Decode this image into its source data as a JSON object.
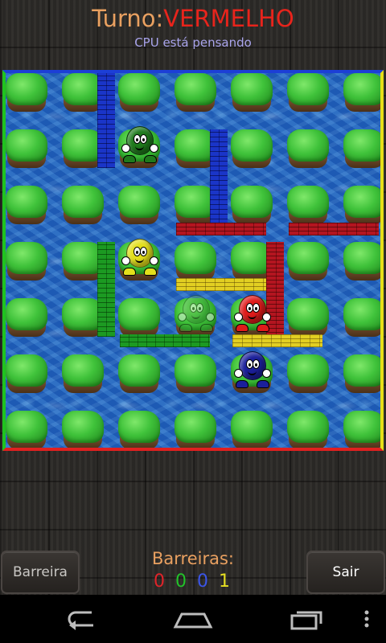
{
  "header": {
    "turn_label": "Turno:",
    "turn_player": "VERMELHO",
    "status": "CPU está pensando"
  },
  "board": {
    "rows": 7,
    "cols": 7,
    "border_colors": {
      "top": "#1c3fd6",
      "bottom": "#e02020",
      "left": "#1fc31f",
      "right": "#e6df18"
    },
    "pawns": [
      {
        "name": "green-pawn",
        "color": "#1f7a1c",
        "row": 1,
        "col": 2,
        "ghost": false
      },
      {
        "name": "yellow-pawn",
        "color": "#e3df1c",
        "row": 3,
        "col": 2,
        "ghost": false
      },
      {
        "name": "green-pawn-ghost",
        "color": "#3da839",
        "row": 4,
        "col": 3,
        "ghost": true
      },
      {
        "name": "red-pawn",
        "color": "#e01b1b",
        "row": 4,
        "col": 4,
        "ghost": false
      },
      {
        "name": "blue-pawn",
        "color": "#1b1f9a",
        "row": 5,
        "col": 4,
        "ghost": false
      }
    ]
  },
  "footer": {
    "barrier_button": "Barreira",
    "exit_button": "Sair",
    "barriers_title": "Barreiras:",
    "counts": [
      {
        "player": "red",
        "value": "0",
        "color": "#e0242a"
      },
      {
        "player": "green",
        "value": "0",
        "color": "#22c22a"
      },
      {
        "player": "blue",
        "value": "0",
        "color": "#3b55e8"
      },
      {
        "player": "yellow",
        "value": "1",
        "color": "#e6df22"
      }
    ]
  },
  "navbar": {
    "icons": [
      "back-icon",
      "home-icon",
      "recent-apps-icon",
      "menu-icon"
    ]
  }
}
